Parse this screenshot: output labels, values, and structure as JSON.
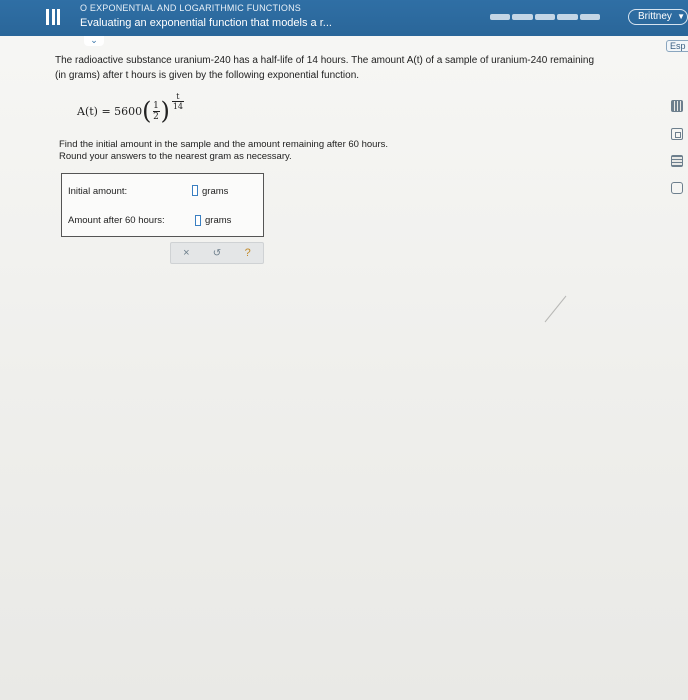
{
  "header": {
    "subtitle": "O EXPONENTIAL AND LOGARITHMIC FUNCTIONS",
    "title": "Evaluating an exponential function that models a r...",
    "user_name": "Brittney",
    "collapse_icon": "chevron-down-icon"
  },
  "sidebar": {
    "esp_label": "Esp"
  },
  "problem": {
    "statement_line1": "The radioactive substance uranium-240 has a half-life of 14 hours. The amount A(t) of a sample of uranium-240 remaining",
    "statement_line2": "(in grams) after t hours is given by the following exponential function.",
    "formula_lhs": "A(t) = 5600",
    "base_num": "1",
    "base_den": "2",
    "exp_num": "t",
    "exp_den": "14",
    "instruction_line1": "Find the initial amount in the sample and the amount remaining after 60 hours.",
    "instruction_line2": "Round your answers to the nearest gram as necessary."
  },
  "answers": {
    "initial_label": "Initial amount:",
    "initial_unit": "grams",
    "after_label": "Amount after 60 hours:",
    "after_unit": "grams"
  },
  "actions": {
    "clear": "×",
    "undo": "↺",
    "help": "?"
  },
  "colors": {
    "header_bg": "#2f6fa5",
    "input_border": "#3a7fc1",
    "help": "#c28a2a"
  }
}
